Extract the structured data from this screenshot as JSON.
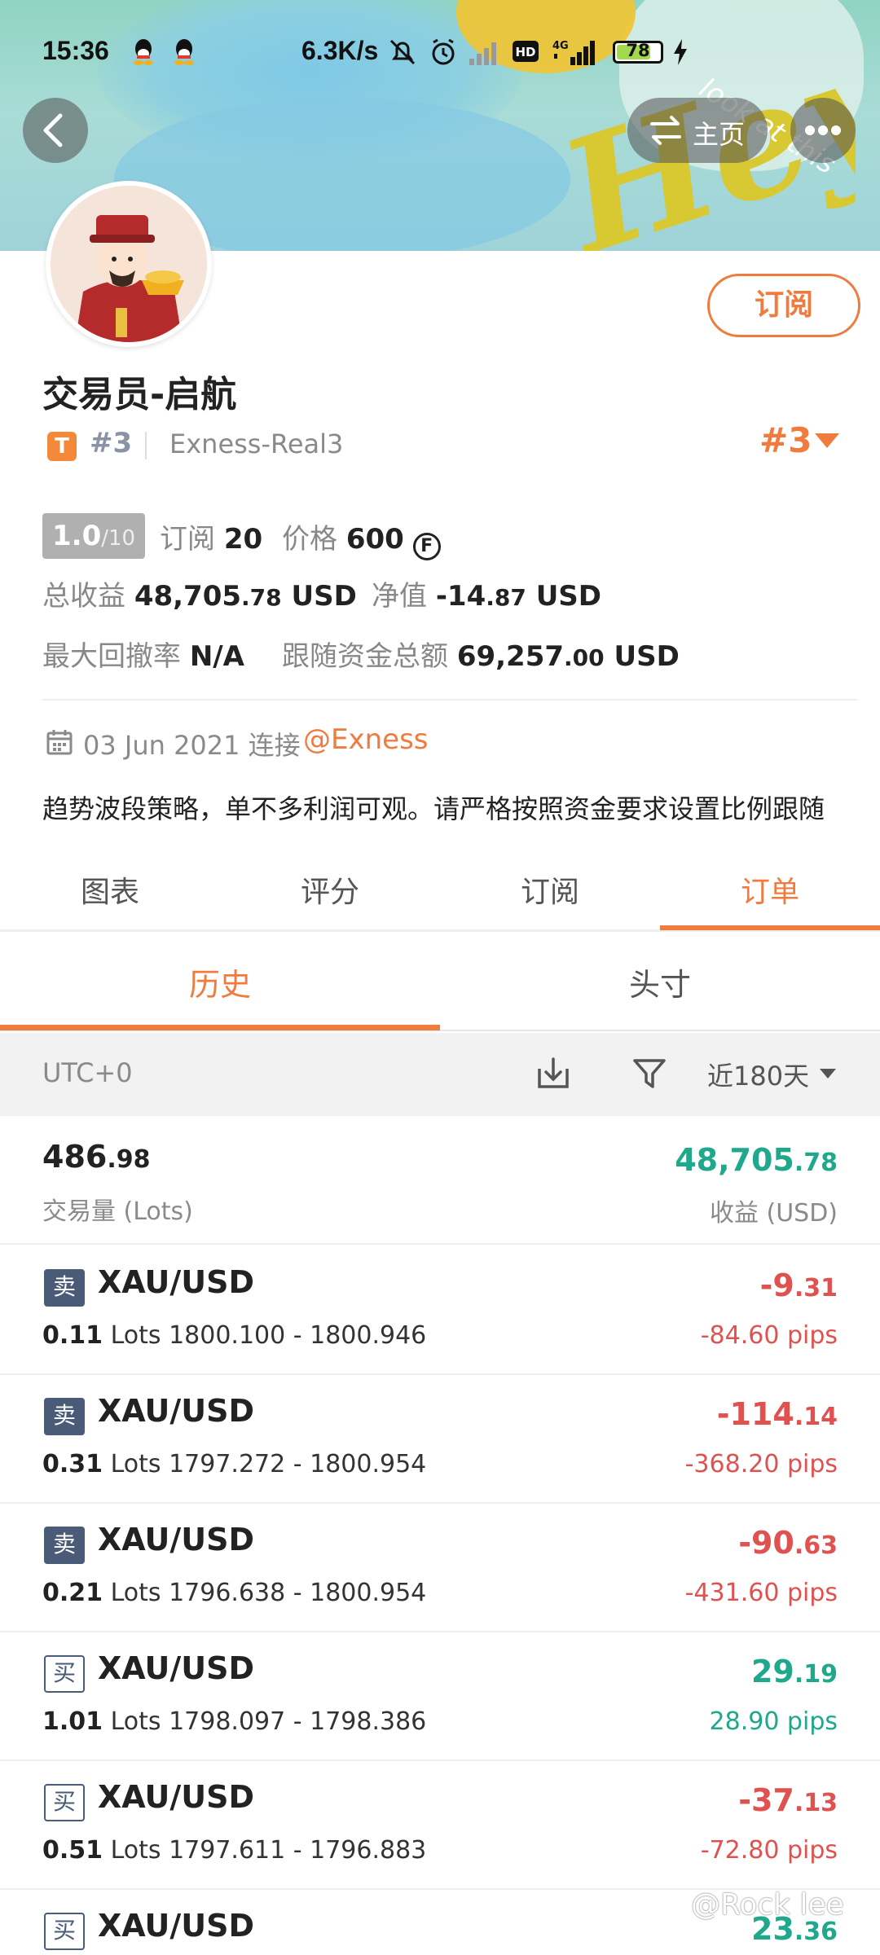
{
  "status_bar": {
    "time": "15:36",
    "net_speed": "6.3K/s",
    "battery": "78",
    "battery_fraction": 0.78,
    "network": "4G"
  },
  "header": {
    "home_label": "主页",
    "banner_text": "Hey",
    "banner_subtext": "look at this"
  },
  "profile": {
    "name": "交易员-启航",
    "badge_letter": "T",
    "rank_small": "#3",
    "server": "Exness-Real3",
    "rank_big": "#3",
    "subscribe_label": "订阅",
    "score": "1.0",
    "score_den": "/10",
    "subs_label": "订阅",
    "subs_count": "20",
    "price_label": "价格",
    "price_value": "600",
    "price_icon": "F",
    "total_profit_label": "总收益",
    "total_profit_main": "48,705",
    "total_profit_dec": ".78",
    "total_profit_unit": "USD",
    "equity_label": "净值",
    "equity_main": "-14",
    "equity_dec": ".87",
    "equity_unit": "USD",
    "drawdown_label": "最大回撤率",
    "drawdown_value": "N/A",
    "follow_label": "跟随资金总额",
    "follow_main": "69,257",
    "follow_dec": ".00",
    "follow_unit": "USD",
    "date": "03 Jun 2021",
    "connect_label": "连接",
    "broker_link": "@Exness",
    "description": "趋势波段策略，单不多利润可观。请严格按照资金要求设置比例跟随"
  },
  "tabs": [
    {
      "label": "图表"
    },
    {
      "label": "评分"
    },
    {
      "label": "订阅"
    },
    {
      "label": "订单"
    }
  ],
  "subtabs": [
    {
      "label": "历史"
    },
    {
      "label": "头寸"
    }
  ],
  "filter": {
    "timezone": "UTC+0",
    "period": "近180天"
  },
  "summary": {
    "volume_main": "486",
    "volume_dec": ".98",
    "volume_label": "交易量 (Lots)",
    "profit_main": "48,705",
    "profit_dec": ".78",
    "profit_label": "收益 (USD)"
  },
  "orders": [
    {
      "side": "卖",
      "symbol": "XAU/USD",
      "lots": "0.11",
      "lots_unit": "Lots",
      "range": "1800.100 - 1800.946",
      "pnl_main": "-9",
      "pnl_dec": ".31",
      "pips": "-84.60 pips"
    },
    {
      "side": "卖",
      "symbol": "XAU/USD",
      "lots": "0.31",
      "lots_unit": "Lots",
      "range": "1797.272 - 1800.954",
      "pnl_main": "-114",
      "pnl_dec": ".14",
      "pips": "-368.20 pips"
    },
    {
      "side": "卖",
      "symbol": "XAU/USD",
      "lots": "0.21",
      "lots_unit": "Lots",
      "range": "1796.638 - 1800.954",
      "pnl_main": "-90",
      "pnl_dec": ".63",
      "pips": "-431.60 pips"
    },
    {
      "side": "买",
      "symbol": "XAU/USD",
      "lots": "1.01",
      "lots_unit": "Lots",
      "range": "1798.097 - 1798.386",
      "pnl_main": "29",
      "pnl_dec": ".19",
      "pips": "28.90 pips"
    },
    {
      "side": "买",
      "symbol": "XAU/USD",
      "lots": "0.51",
      "lots_unit": "Lots",
      "range": "1797.611 - 1796.883",
      "pnl_main": "-37",
      "pnl_dec": ".13",
      "pips": "-72.80 pips"
    },
    {
      "side": "买",
      "symbol": "XAU/USD",
      "lots": "",
      "lots_unit": "",
      "range": "",
      "pnl_main": "23",
      "pnl_dec": ".36",
      "pips": ""
    }
  ],
  "watermark": "@Rock lee",
  "colors": {
    "accent": "#f07b3f",
    "positive": "#1fa88c",
    "negative": "#e0524f",
    "sell_badge": "#4a5b77"
  }
}
